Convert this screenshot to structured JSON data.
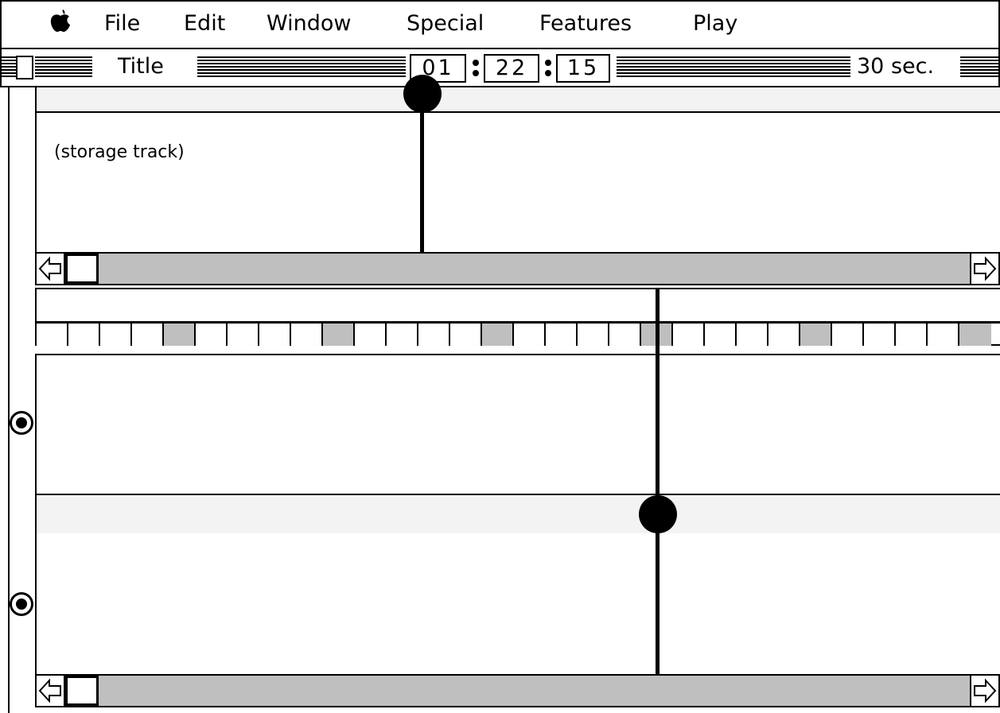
{
  "menubar": {
    "apple": "",
    "items": [
      "File",
      "Edit",
      "Window",
      "Special",
      "Features",
      "Play"
    ]
  },
  "titlebar": {
    "title": "Title",
    "timecode": {
      "hours": "01",
      "minutes": "22",
      "seconds": "15"
    },
    "scale": "30 sec."
  },
  "storage_track": {
    "label": "(storage track)"
  },
  "timeline": {
    "segment_count": 30,
    "shaded_segments": [
      4,
      9,
      14,
      19,
      24,
      29
    ]
  },
  "colors": {
    "scroll_track": "#bfbfbf",
    "band": "#f3f3f3",
    "segment_shaded": "#bfbfbf"
  },
  "icons": [
    "apple-icon",
    "close-box-icon",
    "left-arrow-icon",
    "right-arrow-icon",
    "radio-selected-icon",
    "timecode-colon-icon"
  ]
}
